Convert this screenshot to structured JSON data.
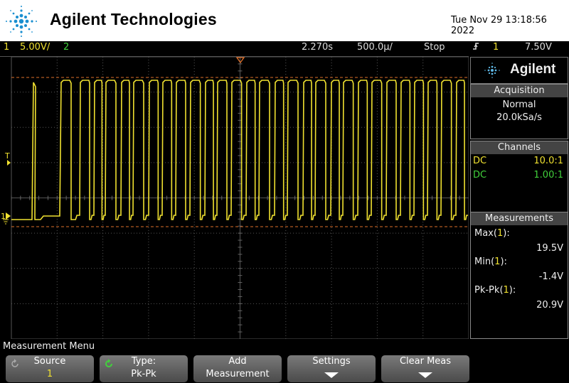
{
  "header": {
    "brand": "Agilent Technologies",
    "datetime": "Tue Nov 29 13:18:56 2022"
  },
  "status": {
    "ch1_num": "1",
    "ch1_scale": "5.00V/",
    "ch2_num": "2",
    "h_position": "2.270s",
    "timebase": "500.0μ/",
    "run_state": "Stop",
    "trigger_icon": "trigger-edge-icon",
    "trigger_source": "1",
    "trigger_level": "7.50V"
  },
  "side_panel": {
    "logo": "Agilent",
    "acquisition": {
      "title": "Acquisition",
      "mode": "Normal",
      "rate": "20.0kSa/s"
    },
    "channels": {
      "title": "Channels",
      "rows": [
        {
          "coupling": "DC",
          "probe": "10.0:1",
          "color": "#f0e130"
        },
        {
          "coupling": "DC",
          "probe": "1.00:1",
          "color": "#41d13b"
        }
      ]
    },
    "measurements": {
      "title": "Measurements",
      "items": [
        {
          "name": "Max",
          "src": "1",
          "value": "19.5V"
        },
        {
          "name": "Min",
          "src": "1",
          "value": "-1.4V"
        },
        {
          "name": "Pk-Pk",
          "src": "1",
          "value": "20.9V"
        }
      ]
    }
  },
  "screen": {
    "trigger_marker": "T",
    "ch1_marker": "1"
  },
  "menu": {
    "title": "Measurement Menu",
    "softkeys": [
      {
        "line1": "Source",
        "line2": "1"
      },
      {
        "line1": "Type:",
        "line2": "Pk-Pk"
      },
      {
        "line1": "Add",
        "line2": "Measurement"
      },
      {
        "line1": "Settings",
        "line2": ""
      },
      {
        "line1": "Clear Meas",
        "line2": ""
      }
    ]
  },
  "colors": {
    "ch1": "#f0e130",
    "ch2": "#41d13b",
    "cursor": "#e0702a"
  }
}
